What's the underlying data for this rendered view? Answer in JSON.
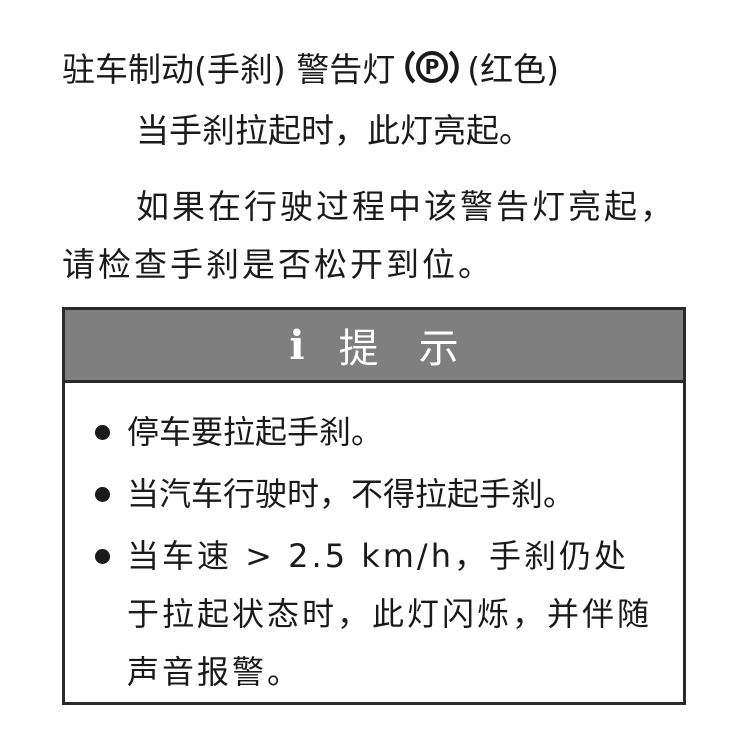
{
  "heading": {
    "text": "驻车制动(手刹) 警告灯",
    "symbol_letter": "P",
    "color_note": "(红色)"
  },
  "paragraphs": [
    "当手刹拉起时，此灯亮起。",
    "如果在行驶过程中该警告灯亮起，请检查手刹是否松开到位。"
  ],
  "tip": {
    "icon": "i",
    "title": "提示",
    "items": [
      "停车要拉起手刹。",
      "当汽车行驶时，不得拉起手刹。",
      "当车速 > 2.5 km/h，手刹仍处于拉起状态时，此灯闪烁，并伴随声音报警。"
    ]
  },
  "colors": {
    "text": "#1a1a1a",
    "tip_header_bg": "#7f7f7f",
    "tip_header_text": "#ffffff",
    "border": "#2a2a2a"
  }
}
